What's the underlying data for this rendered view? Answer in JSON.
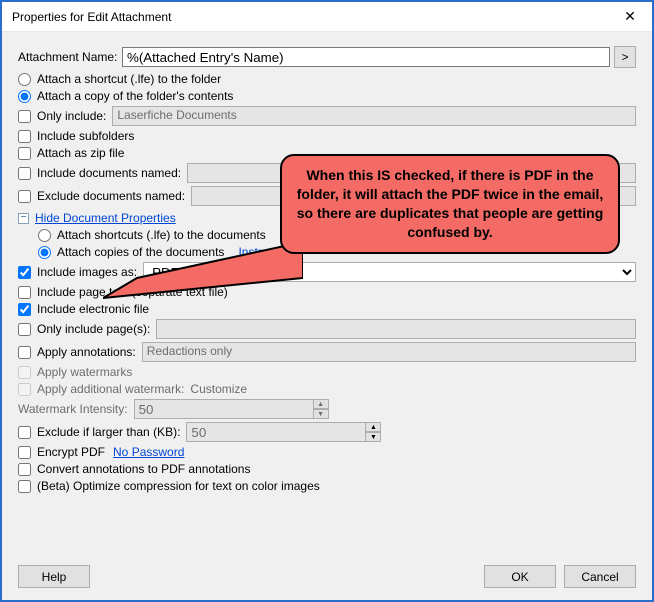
{
  "window": {
    "title": "Properties for Edit Attachment"
  },
  "attachmentName": {
    "label": "Attachment Name:",
    "value": "%(Attached Entry's Name)"
  },
  "attachMode": {
    "shortcut": "Attach a shortcut (.lfe) to the folder",
    "copy": "Attach a copy of the folder's contents"
  },
  "onlyIncludeType": {
    "label": "Only include:",
    "value": "Laserfiche Documents"
  },
  "subfolders": "Include subfolders",
  "asZip": "Attach as zip file",
  "includeNamed": "Include documents named:",
  "excludeNamed": "Exclude documents named:",
  "treeLink": "Hide Document Properties",
  "docMode": {
    "shortcuts": "Attach shortcuts (.lfe) to the documents",
    "copies": "Attach copies of the documents",
    "instructions": "Instructions"
  },
  "includeImages": {
    "label": "Include images as:",
    "value": "PDF"
  },
  "pageText": "Include page text (separate text file)",
  "electronicFile": "Include electronic file",
  "onlyPages": "Only include page(s):",
  "applyAnnotations": {
    "label": "Apply annotations:",
    "value": "Redactions only"
  },
  "applyWatermarks": "Apply watermarks",
  "additionalWatermark": {
    "label": "Apply additional watermark:",
    "link": "Customize"
  },
  "watermarkIntensity": {
    "label": "Watermark Intensity:",
    "value": "50"
  },
  "excludeLarger": {
    "label": "Exclude if larger than (KB):",
    "value": "50"
  },
  "encryptPdf": {
    "label": "Encrypt PDF",
    "link": "No Password"
  },
  "convertAnnotations": "Convert annotations to PDF annotations",
  "betaOptimize": "(Beta) Optimize compression for text on color images",
  "buttons": {
    "help": "Help",
    "ok": "OK",
    "cancel": "Cancel"
  },
  "callout": "When this IS checked, if there is PDF in the folder, it will attach the PDF twice in the email, so there are duplicates that people are getting confused by."
}
